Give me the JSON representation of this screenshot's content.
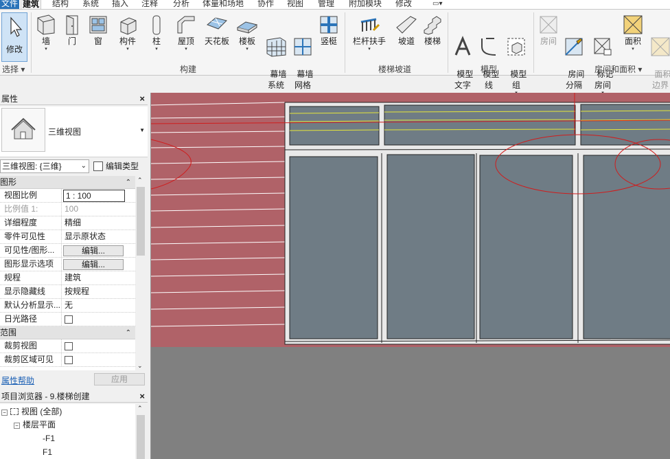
{
  "menu": {
    "tabs": [
      "文件",
      "建筑",
      "结构",
      "系统",
      "插入",
      "注释",
      "分析",
      "体量和场地",
      "协作",
      "视图",
      "管理",
      "附加模块",
      "修改"
    ],
    "active_tab": "建筑"
  },
  "ribbon": {
    "modify_label": "修改",
    "select_group": "选择",
    "build_buttons": [
      "墙",
      "门",
      "窗",
      "构件",
      "柱",
      "屋顶",
      "天花板",
      "楼板",
      "幕墙\n系统",
      "幕墙\n网格",
      "竖梃"
    ],
    "build_group": "构建",
    "stair_buttons": [
      "栏杆扶手",
      "坡道",
      "楼梯"
    ],
    "stair_group": "楼梯坡道",
    "model_buttons": [
      "模型\n文字",
      "模型\n线",
      "模型\n组"
    ],
    "model_group": "模型",
    "room_buttons": [
      "房间",
      "房间\n分隔",
      "标记\n房间",
      "面积",
      "面积\n边界"
    ],
    "room_group": "房间和面积"
  },
  "properties": {
    "title": "属性",
    "close": "×",
    "type_name": "三维视图",
    "view_selector": "三维视图: {三维}",
    "edit_type": "编辑类型",
    "section_graphics": "图形",
    "rows": [
      {
        "key": "视图比例",
        "value": "1 : 100"
      },
      {
        "key": "比例值 1:",
        "value": "100"
      },
      {
        "key": "详细程度",
        "value": "精细"
      },
      {
        "key": "零件可见性",
        "value": "显示原状态"
      },
      {
        "key": "可见性/图形...",
        "value": "编辑..."
      },
      {
        "key": "图形显示选项",
        "value": "编辑..."
      },
      {
        "key": "规程",
        "value": "建筑"
      },
      {
        "key": "显示隐藏线",
        "value": "按规程"
      },
      {
        "key": "默认分析显示...",
        "value": "无"
      },
      {
        "key": "日光路径",
        "value": ""
      }
    ],
    "section_range": "范围",
    "range_rows": [
      {
        "key": "裁剪视图",
        "value": ""
      },
      {
        "key": "裁剪区域可见",
        "value": ""
      }
    ],
    "help_link": "属性帮助",
    "apply": "应用"
  },
  "browser": {
    "title": "项目浏览器 - 9.楼梯创建",
    "close": "×",
    "nodes": [
      "视图 (全部)",
      "楼层平面",
      "-F1",
      "F1"
    ]
  },
  "colors": {
    "brick": "#b06268",
    "glass": "#6f7c85",
    "frame": "#eaeaea",
    "background": "#808080",
    "accent": "#2b74b9"
  }
}
